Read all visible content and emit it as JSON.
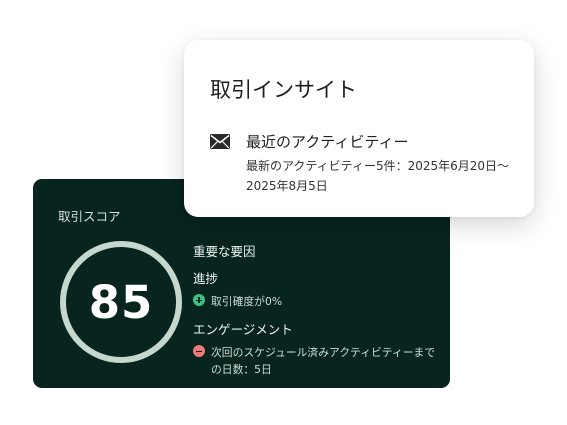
{
  "score_card": {
    "label": "取引スコア",
    "score": "85",
    "factors_title": "重要な要因",
    "groups": [
      {
        "title": "進捗",
        "items": [
          {
            "sign": "positive",
            "text": "取引確度が0%"
          }
        ]
      },
      {
        "title": "エンゲージメント",
        "items": [
          {
            "sign": "negative",
            "text": "次回のスケジュール済みアクティビティーまでの日数：5日"
          }
        ]
      }
    ],
    "colors": {
      "background": "#07241f",
      "ring": "#c4d8cd",
      "positive": "#3fbf86",
      "negative": "#ee7a77"
    }
  },
  "insight_card": {
    "title": "取引インサイト",
    "activity": {
      "icon": "mail-icon",
      "title": "最近のアクティビティー",
      "detail": "最新のアクティビティー5件：2025年6月20日〜2025年8月5日"
    }
  }
}
